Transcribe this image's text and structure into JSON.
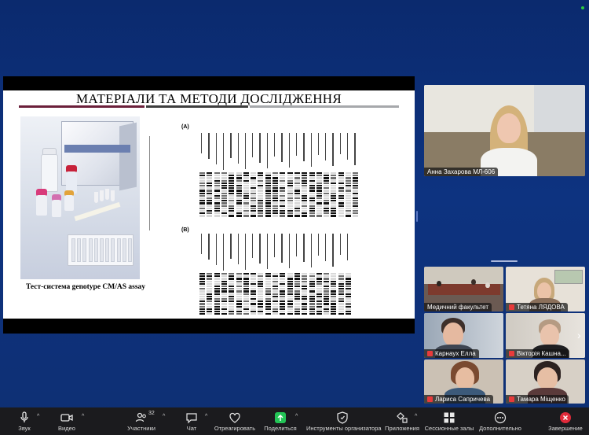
{
  "slide": {
    "title": "МАТЕРІАЛИ ТА МЕТОДИ ДОСЛІДЖЕННЯ",
    "caption": "Тест-система genotype CM/AS assay",
    "panel_a": "(A)",
    "panel_b": "(B)"
  },
  "participants": [
    {
      "name": "Анна Захарова МЛ-606"
    },
    {
      "name": "Медичний факультет"
    },
    {
      "name": "Тетяна ЛЯДОВА"
    },
    {
      "name": "Карнаух Елла"
    },
    {
      "name": "Вікторія Кашна..."
    },
    {
      "name": "Лариса Сапричева"
    },
    {
      "name": "Тамара Міщенко"
    }
  ],
  "toolbar": {
    "audio": "Звук",
    "video": "Видео",
    "participants": "Участники",
    "participants_count": "32",
    "chat": "Чат",
    "react": "Отреагировать",
    "share": "Поделиться",
    "host_tools": "Инструменты организатора",
    "apps": "Приложения",
    "breakout": "Сессионные залы",
    "more": "Дополнительно",
    "end": "Завершение"
  },
  "colors": {
    "accent_green": "#23c456",
    "end_red": "#e02a3a",
    "background": "#0d3380"
  },
  "icons": [
    "microphone-icon",
    "camera-icon",
    "participants-icon",
    "chat-icon",
    "heart-icon",
    "share-arrow-icon",
    "shield-icon",
    "apps-icon",
    "grid-icon",
    "more-dots-icon",
    "close-icon"
  ]
}
